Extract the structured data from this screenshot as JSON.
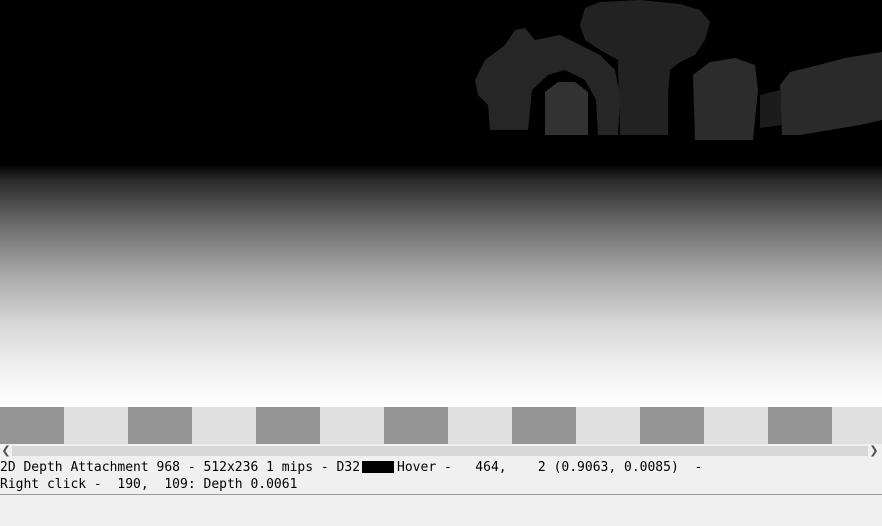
{
  "status": {
    "line1_prefix": "2D Depth Attachment 968 - 512x236 1 mips - D32",
    "line1_suffix": "Hover -   464,    2 (0.9063, 0.0085)  -",
    "line2": "Right click -  190,  109: Depth 0.0061",
    "swatch_color": "#000000"
  },
  "scrollbar": {
    "left_arrow_icon": "chevron-left-icon",
    "right_arrow_icon": "chevron-right-icon"
  },
  "colors": {
    "background": "#000000",
    "checker_dark": "#959595",
    "checker_light": "#e0e0e0",
    "status_bg": "#f0f0f0"
  }
}
